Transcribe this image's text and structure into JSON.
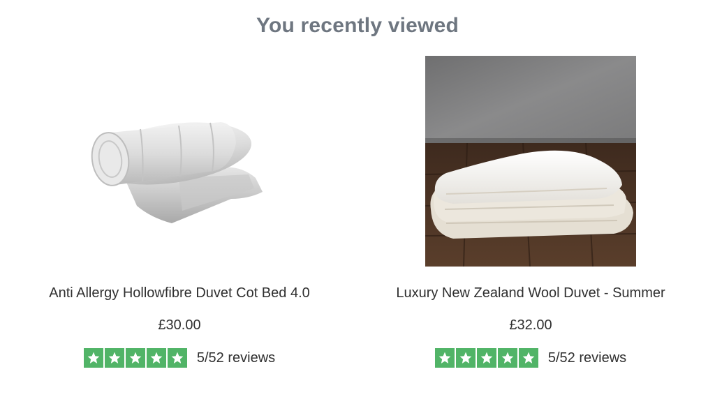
{
  "section": {
    "title": "You recently viewed"
  },
  "colors": {
    "title": "#6e7680",
    "star_bg": "#51b467",
    "star_fg": "#ffffff",
    "text": "#2f2f2f"
  },
  "products": [
    {
      "title": "Anti Allergy Hollowfibre Duvet Cot Bed 4.0",
      "price": "£30.00",
      "rating_stars": 5,
      "reviews_text": "5/52 reviews",
      "image_icon": "rolled-duvet-image"
    },
    {
      "title": "Luxury New Zealand Wool Duvet - Summer",
      "price": "£32.00",
      "rating_stars": 5,
      "reviews_text": "5/52 reviews",
      "image_icon": "folded-wool-duvet-image"
    }
  ]
}
